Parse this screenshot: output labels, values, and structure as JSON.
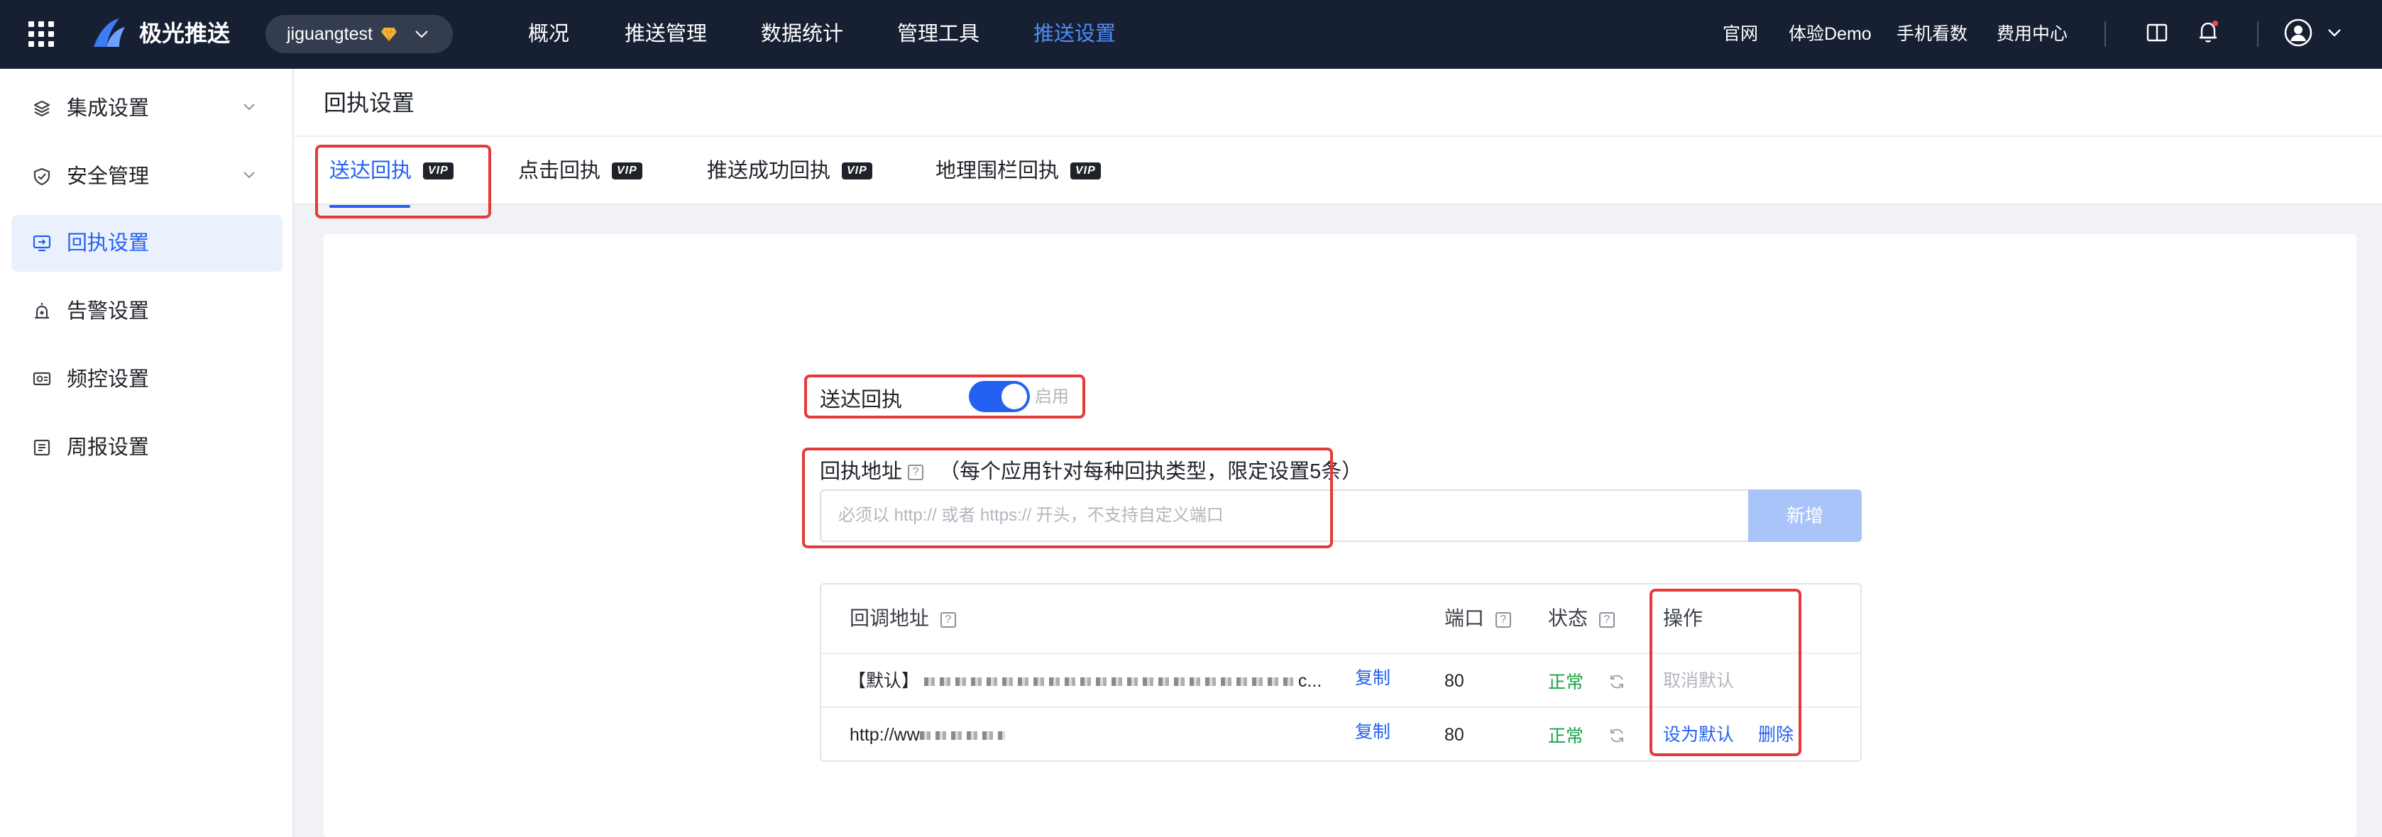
{
  "topbar": {
    "brand": "极光推送",
    "app_name": "jiguangtest",
    "nav": [
      "概况",
      "推送管理",
      "数据统计",
      "管理工具",
      "推送设置"
    ],
    "active_nav": "推送设置",
    "links": [
      "官网",
      "体验Demo",
      "手机看数",
      "费用中心"
    ],
    "icons": [
      "apps-grid-icon",
      "jiguang-logo",
      "gem-icon",
      "chevron-down-icon",
      "book-icon",
      "bell-icon",
      "user-avatar-icon"
    ]
  },
  "sidebar": {
    "items": [
      {
        "label": "集成设置",
        "icon": "layers-icon",
        "expandable": true
      },
      {
        "label": "安全管理",
        "icon": "shield-icon",
        "expandable": true
      },
      {
        "label": "回执设置",
        "icon": "receipt-screen-icon",
        "active": true
      },
      {
        "label": "告警设置",
        "icon": "alarm-icon"
      },
      {
        "label": "频控设置",
        "icon": "frequency-icon"
      },
      {
        "label": "周报设置",
        "icon": "report-icon"
      }
    ]
  },
  "page": {
    "title": "回执设置",
    "tabs": [
      {
        "label": "送达回执",
        "badge": "VIP",
        "active": true
      },
      {
        "label": "点击回执",
        "badge": "VIP"
      },
      {
        "label": "推送成功回执",
        "badge": "VIP"
      },
      {
        "label": "地理围栏回执",
        "badge": "VIP"
      }
    ]
  },
  "form": {
    "toggle_label": "送达回执",
    "toggle_state_text": "启用",
    "toggle_on": true,
    "address_label": "回执地址",
    "address_hint": "（每个应用针对每种回执类型，限定设置5条）",
    "input_placeholder": "必须以 http:// 或者 https:// 开头，不支持自定义端口",
    "add_button": "新增"
  },
  "table": {
    "headers": {
      "address": "回调地址",
      "port": "端口",
      "status": "状态",
      "action": "操作"
    },
    "rows": [
      {
        "prefix": "【默认】",
        "address_suffix": "c...",
        "copy": "复制",
        "port": "80",
        "status": "正常",
        "actions": [
          "取消默认"
        ]
      },
      {
        "prefix": "http://ww",
        "address_suffix": "",
        "copy": "复制",
        "port": "80",
        "status": "正常",
        "actions": [
          "设为默认",
          "删除"
        ]
      }
    ]
  },
  "colors": {
    "topbar_bg": "#172033",
    "accent": "#2461f2",
    "success": "#1aa34a",
    "annotation": "#e53a3a"
  }
}
